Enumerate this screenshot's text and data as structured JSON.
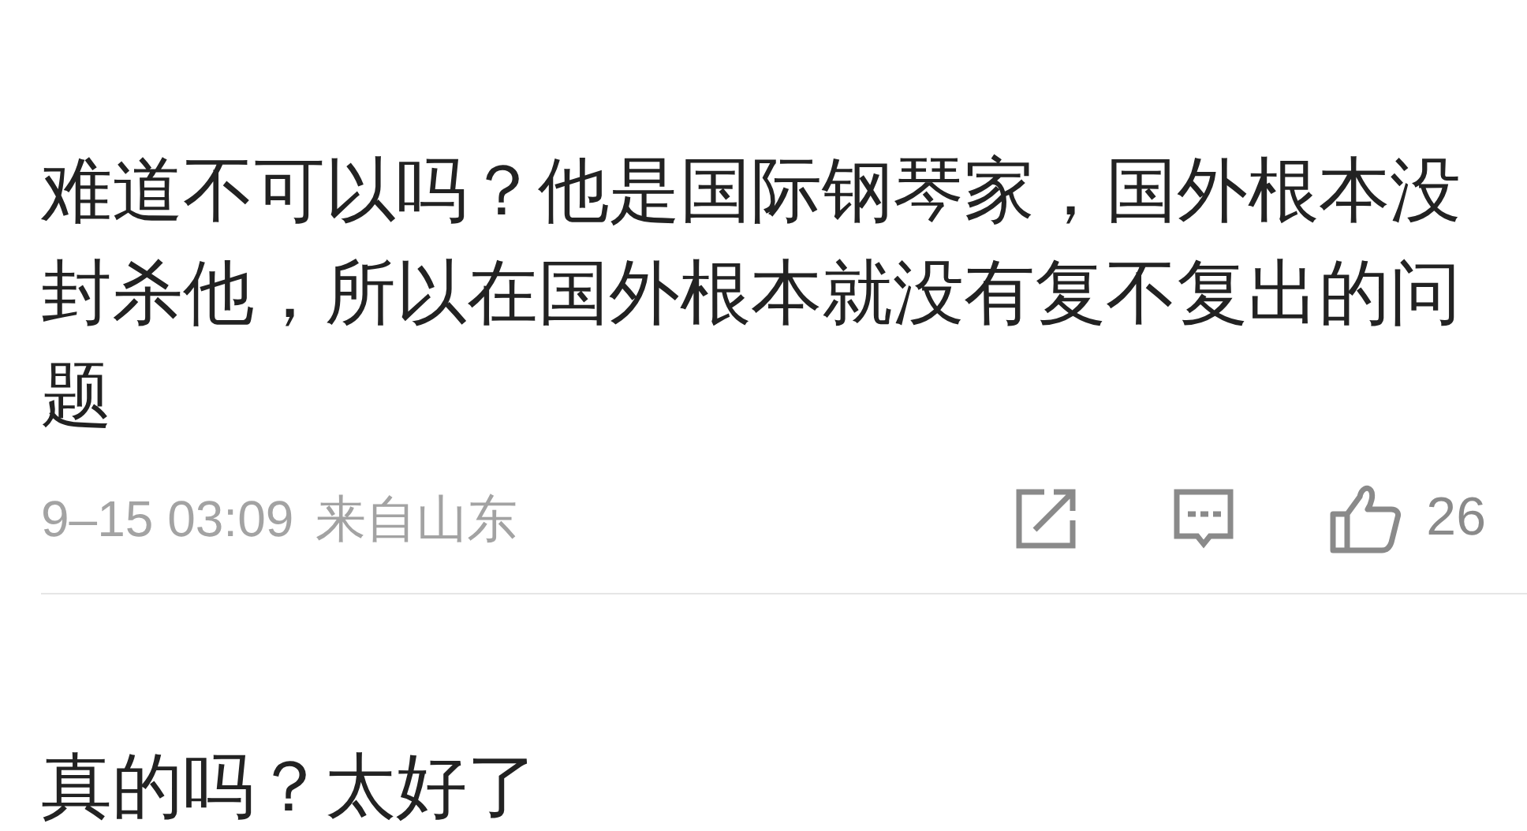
{
  "comments": [
    {
      "text": "难道不可以吗？他是国际钢琴家，国外根本没封杀他，所以在国外根本就没有复不复出的问题",
      "time": "9–15 03:09",
      "location": "来自山东",
      "likes": "26"
    },
    {
      "text": "真的吗？太好了"
    }
  ]
}
